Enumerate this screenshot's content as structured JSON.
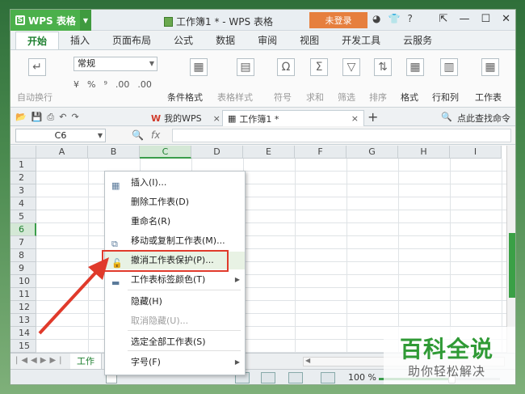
{
  "app": {
    "name": "WPS 表格",
    "doc_title": "工作簿1 * - WPS 表格",
    "login_label": "未登录"
  },
  "ribbon_tabs": [
    "开始",
    "插入",
    "页面布局",
    "公式",
    "数据",
    "审阅",
    "视图",
    "开发工具",
    "云服务"
  ],
  "ribbon": {
    "autofill": "自动换行",
    "number_format": "常规",
    "number_buttons": [
      "%",
      "⁹",
      ".00",
      ".00"
    ],
    "cond_format": "条件格式",
    "table_style": "表格样式",
    "symbol": "符号",
    "sum": "求和",
    "filter": "筛选",
    "sort": "排序",
    "format": "格式",
    "rowcol": "行和列",
    "worksheet": "工作表"
  },
  "doc_tabs": [
    {
      "label": "我的WPS",
      "close": "×"
    },
    {
      "label": "工作簿1 *",
      "close": "×"
    }
  ],
  "search_label": "点此查找命令",
  "formula": {
    "name_box": "C6",
    "fx": "fx"
  },
  "grid": {
    "columns": [
      "A",
      "B",
      "C",
      "D",
      "E",
      "F",
      "G",
      "H",
      "I"
    ],
    "rows": [
      "1",
      "2",
      "3",
      "4",
      "5",
      "6",
      "7",
      "8",
      "9",
      "10",
      "11",
      "12",
      "13",
      "14",
      "15"
    ]
  },
  "context_menu": [
    {
      "label": "插入(I)...",
      "icon": "insert-icon"
    },
    {
      "label": "删除工作表(D)"
    },
    {
      "label": "重命名(R)"
    },
    {
      "label": "移动或复制工作表(M)...",
      "icon": "move-copy-icon"
    },
    {
      "label": "撤消工作表保护(P)...",
      "icon": "unprotect-icon"
    },
    {
      "label": "工作表标签颜色(T)",
      "icon": "tab-color-icon",
      "submenu": true
    },
    {
      "label": "隐藏(H)"
    },
    {
      "label": "取消隐藏(U)...",
      "disabled": true
    },
    {
      "label": "选定全部工作表(S)"
    },
    {
      "label": "字号(F)",
      "submenu": true
    }
  ],
  "sheet_tab": "工作",
  "status": {
    "zoom": "100 %",
    "zoom_level": 0.6
  },
  "watermark": {
    "title": "百科全说",
    "subtitle": "助你轻松解决"
  },
  "colors": {
    "accent": "#3a9d4a",
    "highlight": "#e03a2b",
    "login": "#e67f3e"
  }
}
